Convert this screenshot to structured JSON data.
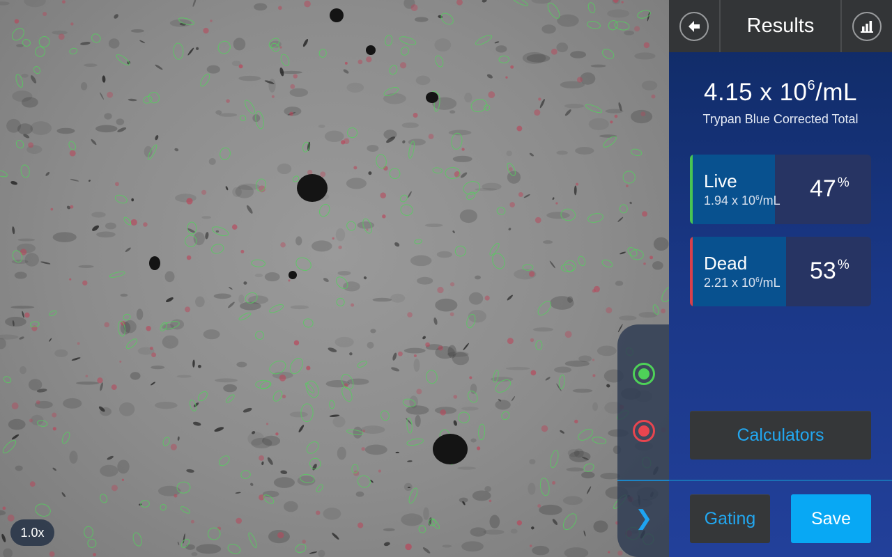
{
  "image_view": {
    "zoom_label": "1.0x",
    "live_outline_color": "#52d15c",
    "dead_outline_color": "#d9455a"
  },
  "overlay_strip": {
    "live_toggle_icon": "live-overlay-radio-icon",
    "dead_toggle_icon": "dead-overlay-radio-icon",
    "expand_icon": "chevron-right-icon",
    "expand_glyph": "❯"
  },
  "header": {
    "back_icon": "back-arrow-icon",
    "title": "Results",
    "chart_icon": "bar-chart-icon"
  },
  "total": {
    "base": "4.15 x 10",
    "exponent": "6",
    "unit": "/mL",
    "caption": "Trypan Blue Corrected Total"
  },
  "live": {
    "label": "Live",
    "conc_base": "1.94 x 10",
    "conc_exponent": "6",
    "conc_unit": "/mL",
    "percent_value": "47",
    "percent_sign": "%",
    "fraction": 0.47,
    "accent": "#49c553"
  },
  "dead": {
    "label": "Dead",
    "conc_base": "2.21 x 10",
    "conc_exponent": "6",
    "conc_unit": "/mL",
    "percent_value": "53",
    "percent_sign": "%",
    "fraction": 0.53,
    "accent": "#d9404b"
  },
  "buttons": {
    "calculators": "Calculators",
    "gating": "Gating",
    "save": "Save"
  },
  "colors": {
    "accent_blue": "#22a7f0",
    "save_blue": "#08a8f4",
    "panel_dark": "#0f2a63"
  }
}
